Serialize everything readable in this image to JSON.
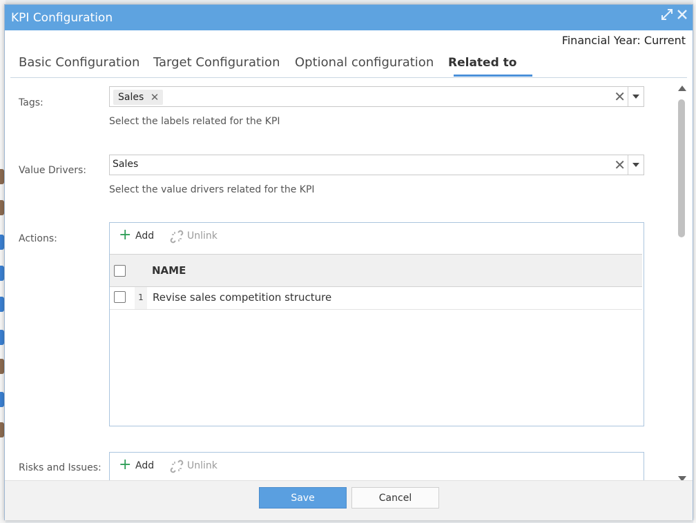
{
  "window": {
    "title": "KPI Configuration",
    "maximize_icon": "expand-arrows-icon",
    "close_icon": "close-icon",
    "title_bar_color": "#5ea3e0"
  },
  "financial_year": "Financial Year: Current",
  "tabs": [
    {
      "label": "Basic Configuration",
      "active": false
    },
    {
      "label": "Target Configuration",
      "active": false
    },
    {
      "label": "Optional configuration",
      "active": false
    },
    {
      "label": "Related to",
      "active": true
    }
  ],
  "tags": {
    "label": "Tags:",
    "chips": [
      "Sales"
    ],
    "hint": "Select the labels related for the KPI"
  },
  "value_drivers": {
    "label": "Value Drivers:",
    "value": "Sales",
    "hint": "Select the value drivers related for the KPI"
  },
  "actions": {
    "label": "Actions:",
    "add_label": "Add",
    "unlink_label": "Unlink",
    "column_header": "NAME",
    "rows": [
      {
        "num": "1",
        "name": "Revise sales competition structure"
      }
    ]
  },
  "risks_issues": {
    "label": "Risks and Issues:",
    "add_label": "Add",
    "unlink_label": "Unlink"
  },
  "footer": {
    "save_label": "Save",
    "cancel_label": "Cancel",
    "save_color": "#5a9fe0"
  }
}
